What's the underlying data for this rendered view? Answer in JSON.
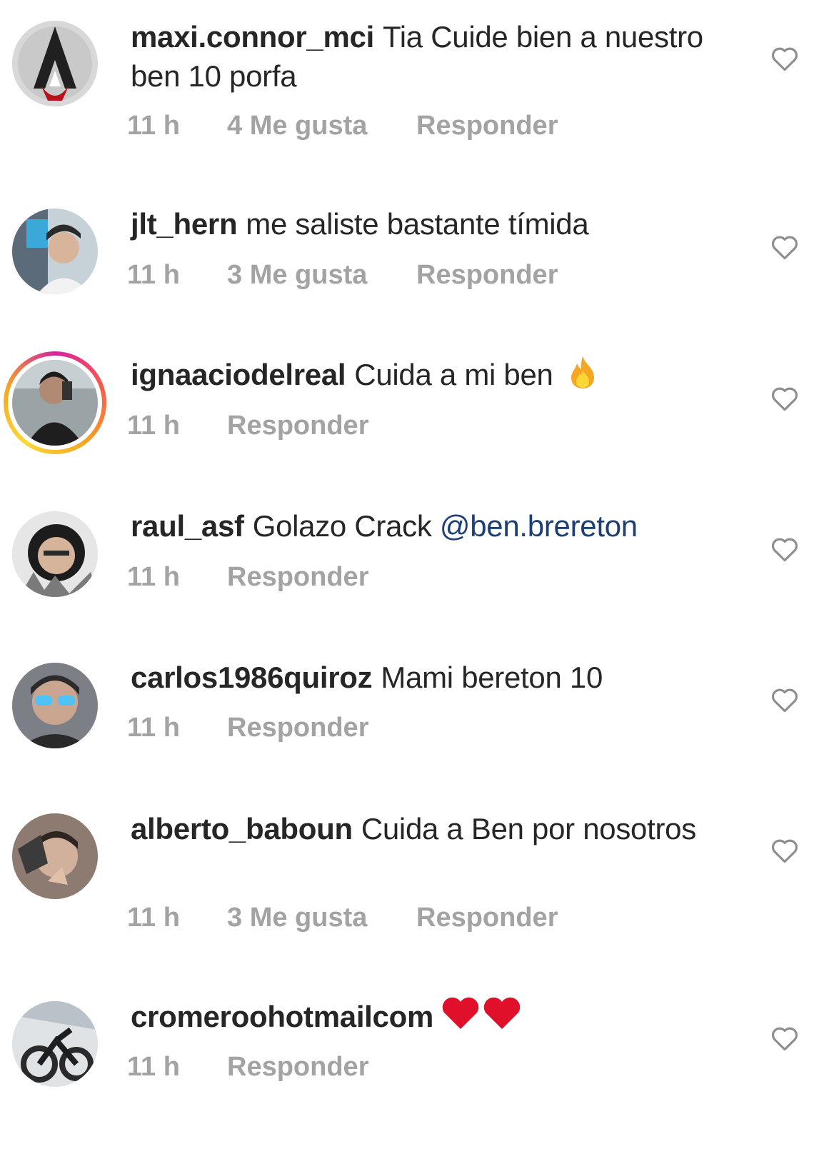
{
  "comments": [
    {
      "username": "maxi.connor_mci",
      "text": "Tia Cuide bien a nuestro ben 10 porfa",
      "time": "11 h",
      "likes": "4 Me gusta",
      "reply": "Responder"
    },
    {
      "username": "jlt_hern",
      "text": "me saliste bastante tímida",
      "time": "11 h",
      "likes": "3 Me gusta",
      "reply": "Responder"
    },
    {
      "username": "ignaaciodelreal",
      "text": "Cuida a mi ben",
      "emoji": "fire-emoji",
      "time": "11 h",
      "reply": "Responder"
    },
    {
      "username": "raul_asf",
      "text": "Golazo Crack",
      "mention": "@ben.brereton",
      "time": "11 h",
      "reply": "Responder"
    },
    {
      "username": "carlos1986quiroz",
      "text": "Mami bereton 10",
      "time": "11 h",
      "reply": "Responder"
    },
    {
      "username": "alberto_baboun",
      "text": "Cuida a Ben por nosotros",
      "time": "11 h",
      "likes": "3 Me gusta",
      "reply": "Responder"
    },
    {
      "username": "cromeroohotmailcom",
      "emoji": "two-red-hearts-emoji",
      "time": "11 h",
      "reply": "Responder"
    }
  ],
  "colors": {
    "text": "#262626",
    "meta": "#a3a3a3",
    "mention": "#1e3f74",
    "heart_outline": "#8e8e8e",
    "red_heart": "#e0102a",
    "story_ring": "#d6249f"
  },
  "icons": {
    "like": "heart-outline-icon"
  }
}
